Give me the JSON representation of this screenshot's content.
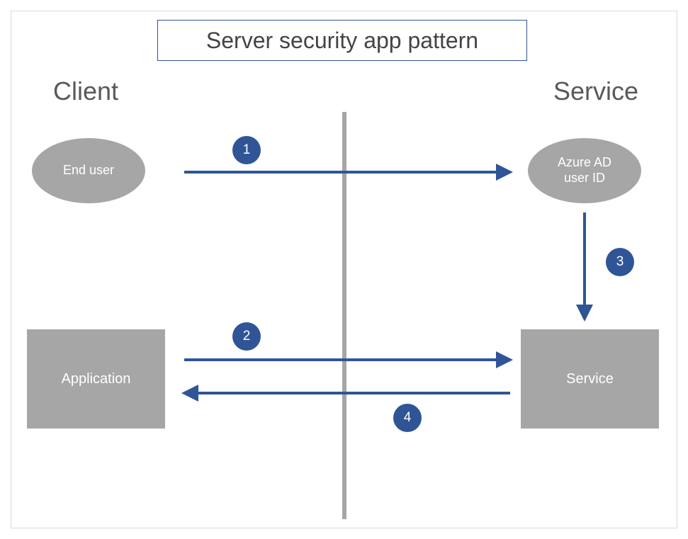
{
  "title": "Server security app pattern",
  "sections": {
    "left": "Client",
    "right": "Service"
  },
  "nodes": {
    "end_user": "End user",
    "azure_ad": "Azure AD\nuser ID",
    "application": "Application",
    "service": "Service"
  },
  "steps": {
    "s1": "1",
    "s2": "2",
    "s3": "3",
    "s4": "4"
  },
  "colors": {
    "arrow": "#2f5597",
    "badge": "#2f5597",
    "node_fill": "#a6a6a6",
    "title_border": "#2f5597"
  },
  "chart_data": {
    "type": "diagram",
    "title": "Server security app pattern",
    "zones": [
      {
        "name": "Client",
        "contains": [
          "End user",
          "Application"
        ]
      },
      {
        "name": "Service",
        "contains": [
          "Azure AD user ID",
          "Service"
        ]
      }
    ],
    "nodes": [
      {
        "id": "end_user",
        "label": "End user",
        "shape": "ellipse",
        "zone": "Client"
      },
      {
        "id": "azure_ad",
        "label": "Azure AD user ID",
        "shape": "ellipse",
        "zone": "Service"
      },
      {
        "id": "application",
        "label": "Application",
        "shape": "rectangle",
        "zone": "Client"
      },
      {
        "id": "service",
        "label": "Service",
        "shape": "rectangle",
        "zone": "Service"
      }
    ],
    "edges": [
      {
        "step": 1,
        "from": "end_user",
        "to": "azure_ad"
      },
      {
        "step": 2,
        "from": "application",
        "to": "service"
      },
      {
        "step": 3,
        "from": "azure_ad",
        "to": "service"
      },
      {
        "step": 4,
        "from": "service",
        "to": "application"
      }
    ]
  }
}
